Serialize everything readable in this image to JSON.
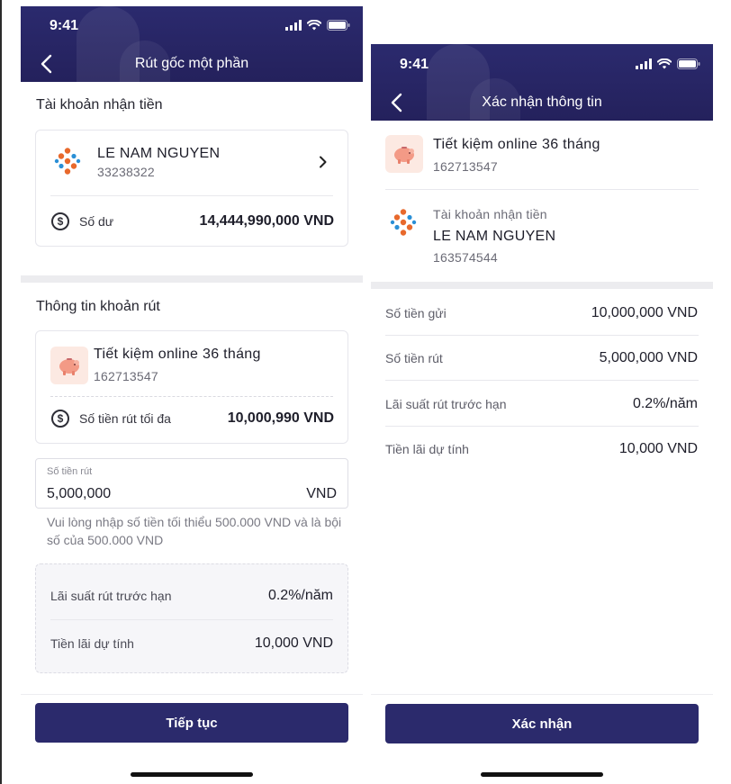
{
  "status_bar": {
    "time": "9:41"
  },
  "withdraw_screen": {
    "title": "Rút gốc một phần",
    "receiving_section_title": "Tài khoản nhận tiền",
    "receiving_account": {
      "name": "LE NAM NGUYEN",
      "number": "33238322"
    },
    "balance_label": "Số dư",
    "balance_value": "14,444,990,000 VND",
    "withdraw_section_title": "Thông tin khoản rút",
    "savings": {
      "name": "Tiết kiệm online 36 tháng",
      "number": "162713547"
    },
    "max_withdraw_label": "Số tiền rút tối đa",
    "max_withdraw_value": "10,000,990 VND",
    "amount_input": {
      "label": "Số tiền rút",
      "value": "5,000,000",
      "unit": "VND"
    },
    "hint": "Vui lòng nhập số tiền tối thiểu 500.000 VND và là bội số của 500.000 VND",
    "early_rate_label": "Lãi suất rút trước hạn",
    "early_rate_value": "0.2%/năm",
    "estimated_interest_label": "Tiền lãi dự tính",
    "estimated_interest_value": "10,000 VND",
    "continue_button": "Tiếp tục"
  },
  "confirm_screen": {
    "title": "Xác nhận thông tin",
    "savings": {
      "name": "Tiết kiệm online 36 tháng",
      "number": "162713547"
    },
    "receiving_label": "Tài khoản nhận tiền",
    "receiving_account": {
      "name": "LE NAM NGUYEN",
      "number": "163574544"
    },
    "rows": [
      {
        "label": "Số tiền gửi",
        "value": "10,000,000 VND"
      },
      {
        "label": "Số tiền rút",
        "value": "5,000,000 VND"
      },
      {
        "label": "Lãi suất rút trước hạn",
        "value": "0.2%/năm"
      },
      {
        "label": "Tiền lãi dự tính",
        "value": "10,000 VND"
      }
    ],
    "confirm_button": "Xác nhận"
  },
  "colors": {
    "header_bg": "#2b2a6e",
    "primary_button": "#2b2a6c",
    "logo_orange": "#e8692c",
    "logo_blue": "#2a8fd6",
    "piggy_bg": "#fce9e2"
  },
  "icons": [
    "back-arrow-icon",
    "signal-icon",
    "wifi-icon",
    "battery-icon",
    "bank-logo-icon",
    "chevron-right-icon",
    "dollar-circle-icon",
    "piggy-bank-icon"
  ]
}
